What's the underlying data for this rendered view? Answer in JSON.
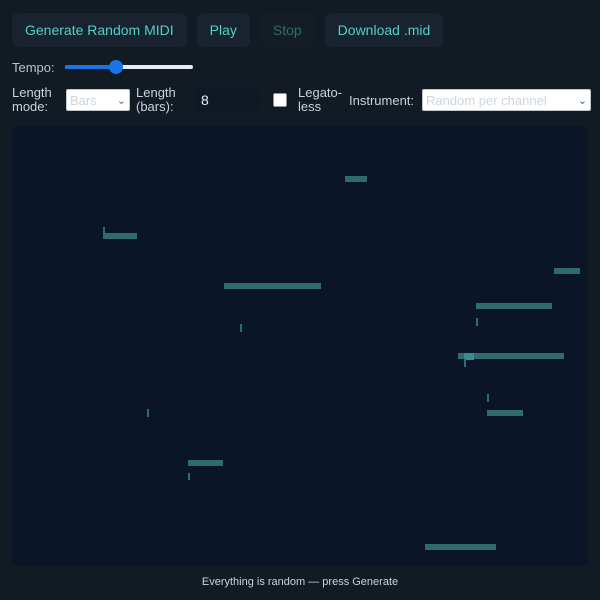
{
  "toolbar": {
    "generate_label": "Generate Random MIDI",
    "play_label": "Play",
    "stop_label": "Stop",
    "download_label": "Download .mid"
  },
  "tempo": {
    "label": "Tempo:",
    "value_fraction": 0.4
  },
  "settings": {
    "length_mode_label_1": "Length",
    "length_mode_label_2": "mode:",
    "length_mode_value": "Bars",
    "length_bars_label_1": "Length",
    "length_bars_label_2": "(bars):",
    "length_bars_value": "8",
    "legato_label_1": "Legato-",
    "legato_label_2": "less",
    "instrument_label": "Instrument:",
    "instrument_value": "Random per channel"
  },
  "status_text": "Everything is random — press Generate",
  "colors": {
    "accent": "#4fd1c5",
    "note": "#2f6b70",
    "roll_bg": "#0a1628"
  }
}
